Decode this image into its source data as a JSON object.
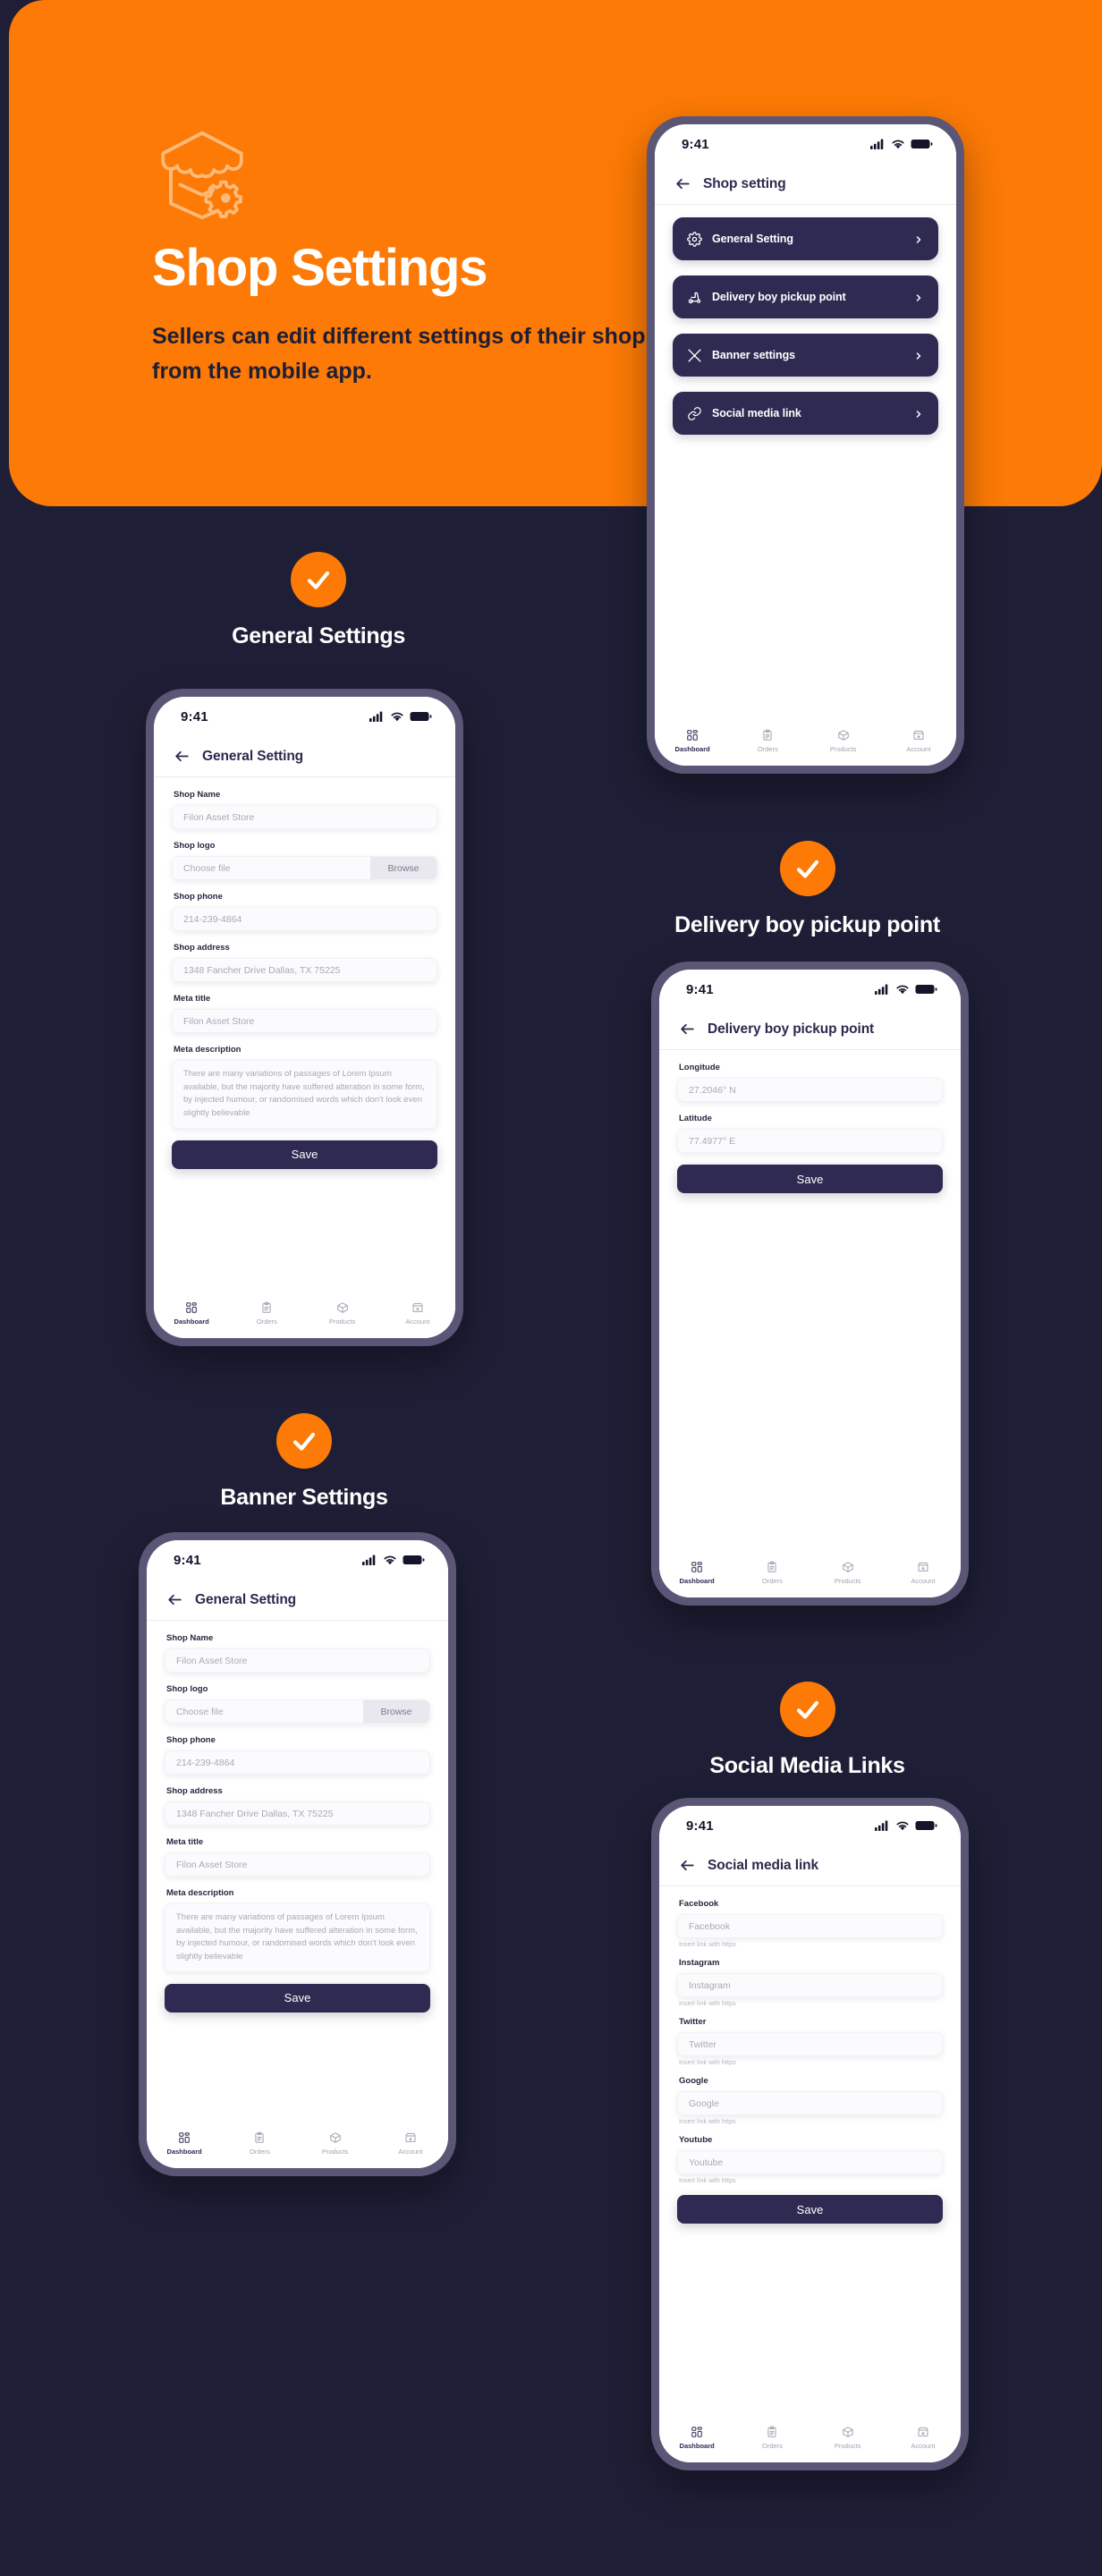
{
  "hero": {
    "title": "Shop Settings",
    "subtitle": "Sellers can edit different settings of their shop from the mobile app.",
    "icon": "shop-settings-icon",
    "bg_color": "#FC7A05",
    "title_color": "#FFFFFF",
    "subtitle_color": "#1E1E36"
  },
  "theme": {
    "page_bg": "#1E1E36",
    "accent": "#FC7A05",
    "dark_card": "#2E2A51",
    "phone_frame": "#5B5675"
  },
  "status_bar": {
    "time": "9:41",
    "icons": [
      "cellular-signal-icon",
      "wifi-icon",
      "battery-icon"
    ]
  },
  "bottom_nav": {
    "items": [
      {
        "label": "Dashboard",
        "icon": "dashboard-grid-icon",
        "active": true
      },
      {
        "label": "Orders",
        "icon": "clipboard-icon",
        "active": false
      },
      {
        "label": "Products",
        "icon": "box-icon",
        "active": false
      },
      {
        "label": "Account",
        "icon": "storefront-icon",
        "active": false
      }
    ]
  },
  "sections": [
    {
      "id": "general-settings",
      "label": "General Settings",
      "badge_icon": "check-icon"
    },
    {
      "id": "delivery-boy-pickup-point",
      "label": "Delivery boy pickup point",
      "badge_icon": "check-icon"
    },
    {
      "id": "banner-settings",
      "label": "Banner Settings",
      "badge_icon": "check-icon"
    },
    {
      "id": "social-media-links",
      "label": "Social Media Links",
      "badge_icon": "check-icon"
    }
  ],
  "screens": {
    "shop_setting": {
      "title": "Shop setting",
      "back_icon": "arrow-left-icon",
      "menu": [
        {
          "label": "General Setting",
          "icon": "gear-icon",
          "chevron": "chevron-right-icon"
        },
        {
          "label": "Delivery boy pickup point",
          "icon": "scooter-icon",
          "chevron": "chevron-right-icon"
        },
        {
          "label": "Banner settings",
          "icon": "tools-icon",
          "chevron": "chevron-right-icon"
        },
        {
          "label": "Social media link",
          "icon": "link-icon",
          "chevron": "chevron-right-icon"
        }
      ]
    },
    "general_setting": {
      "title": "General Setting",
      "back_icon": "arrow-left-icon",
      "fields": [
        {
          "label": "Shop Name",
          "placeholder": "Filon Asset Store",
          "type": "text"
        },
        {
          "label": "Shop logo",
          "placeholder": "Choose file",
          "type": "file",
          "button": "Browse"
        },
        {
          "label": "Shop phone",
          "placeholder": "214-239-4864",
          "type": "text"
        },
        {
          "label": "Shop address",
          "placeholder": "1348 Fancher Drive Dallas, TX 75225",
          "type": "text"
        },
        {
          "label": "Meta title",
          "placeholder": "Filon Asset Store",
          "type": "text"
        },
        {
          "label": "Meta description",
          "placeholder": "There are many variations of passages of Lorem Ipsum available, but the majority have suffered alteration in some form, by injected humour, or randomised words which don't look even slightly believable",
          "type": "textarea"
        }
      ],
      "save_label": "Save"
    },
    "delivery_pickup": {
      "title": "Delivery boy pickup point",
      "back_icon": "arrow-left-icon",
      "fields": [
        {
          "label": "Longitude",
          "placeholder": "27.2046° N",
          "type": "text"
        },
        {
          "label": "Latitude",
          "placeholder": "77.4977° E",
          "type": "text"
        }
      ],
      "save_label": "Save"
    },
    "banner_setting": {
      "title": "General Setting",
      "back_icon": "arrow-left-icon",
      "fields": [
        {
          "label": "Shop Name",
          "placeholder": "Filon Asset Store",
          "type": "text"
        },
        {
          "label": "Shop logo",
          "placeholder": "Choose file",
          "type": "file",
          "button": "Browse"
        },
        {
          "label": "Shop phone",
          "placeholder": "214-239-4864",
          "type": "text"
        },
        {
          "label": "Shop address",
          "placeholder": "1348 Fancher Drive Dallas, TX 75225",
          "type": "text"
        },
        {
          "label": "Meta title",
          "placeholder": "Filon Asset Store",
          "type": "text"
        },
        {
          "label": "Meta description",
          "placeholder": "There are many variations of passages of Lorem Ipsum available, but the majority have suffered alteration in some form, by injected humour, or randomised words which don't look even slightly believable",
          "type": "textarea"
        }
      ],
      "save_label": "Save"
    },
    "social_media": {
      "title": "Social media link",
      "back_icon": "arrow-left-icon",
      "hint": "Insert link with https",
      "fields": [
        {
          "label": "Facebook",
          "placeholder": "Facebook",
          "hint": "Insert link with https"
        },
        {
          "label": "Instagram",
          "placeholder": "Instagram",
          "hint": "Insert link with https"
        },
        {
          "label": "Twitter",
          "placeholder": "Twitter",
          "hint": "Insert link with https"
        },
        {
          "label": "Google",
          "placeholder": "Google",
          "hint": "Insert link with https"
        },
        {
          "label": "Youtube",
          "placeholder": "Youtube",
          "hint": "Insert link with https"
        }
      ],
      "save_label": "Save"
    }
  }
}
